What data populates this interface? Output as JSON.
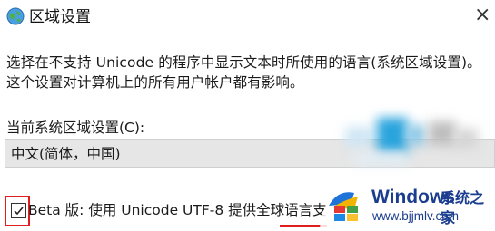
{
  "window": {
    "title": "区域设置",
    "close_glyph": "×"
  },
  "description": "选择在不支持 Unicode 的程序中显示文本时所使用的语言(系统区域设置)。这个设置对计算机上的所有用户帐户都有影响。",
  "locale": {
    "label": "当前系统区域设置(C):",
    "value": "中文(简体，中国)"
  },
  "beta_option": {
    "checked": true,
    "label": "Beta 版: 使用 Unicode UTF-8 提供全球语言支"
  },
  "watermark": {
    "brand": "Windows",
    "brand_cn": "系统之家",
    "url": "www.bjjmlv.com"
  },
  "colors": {
    "highlight": "#e11d1d",
    "watermark_text": "#1b3d8f",
    "blur_blue": "#29a8e0"
  }
}
